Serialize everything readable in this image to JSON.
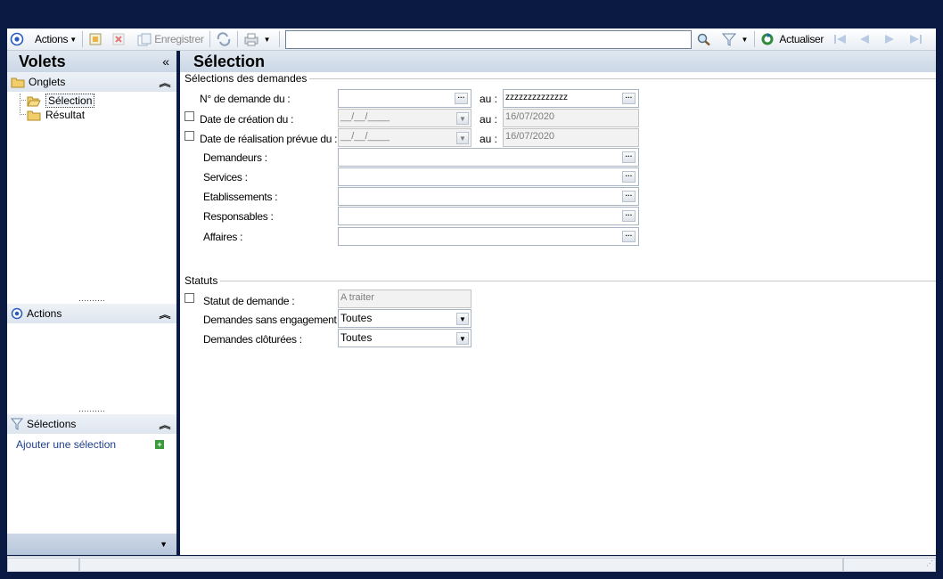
{
  "toolbar": {
    "actions_label": "Actions",
    "save_label": "Enregistrer",
    "search_value": "",
    "refresh_label": "Actualiser"
  },
  "left": {
    "title": "Volets",
    "collapse_glyph": "«",
    "onglets_label": "Onglets",
    "tree": [
      {
        "label": "Sélection"
      },
      {
        "label": "Résultat"
      }
    ],
    "actions_label": "Actions",
    "selections_label": "Sélections",
    "add_selection_label": "Ajouter une sélection"
  },
  "main": {
    "title": "Sélection",
    "group1_title": "Sélections des demandes",
    "group2_title": "Statuts",
    "rows": {
      "num_demande_label": "N° de demande du :",
      "num_demande_from": "",
      "num_demande_au_label": "au :",
      "num_demande_to": "zzzzzzzzzzzzzz",
      "date_creation_label": "Date de création du :",
      "date_creation_from": "__/__/____",
      "date_creation_au_label": "au :",
      "date_creation_to": "16/07/2020",
      "date_realisation_label": "Date de réalisation prévue du :",
      "date_realisation_from": "__/__/____",
      "date_realisation_au_label": "au :",
      "date_realisation_to": "16/07/2020",
      "demandeurs_label": "Demandeurs :",
      "services_label": "Services :",
      "etablissements_label": "Etablissements :",
      "responsables_label": "Responsables :",
      "affaires_label": "Affaires :"
    },
    "statuts": {
      "statut_label": "Statut de demande :",
      "statut_value": "A traiter",
      "sans_engagement_label": "Demandes sans engagement :",
      "sans_engagement_value": "Toutes",
      "cloturees_label": "Demandes clôturées :",
      "cloturees_value": "Toutes"
    }
  },
  "colors": {
    "frame": "#0a1a43",
    "header": "#cbd7e6",
    "link": "#1d3f8c"
  }
}
